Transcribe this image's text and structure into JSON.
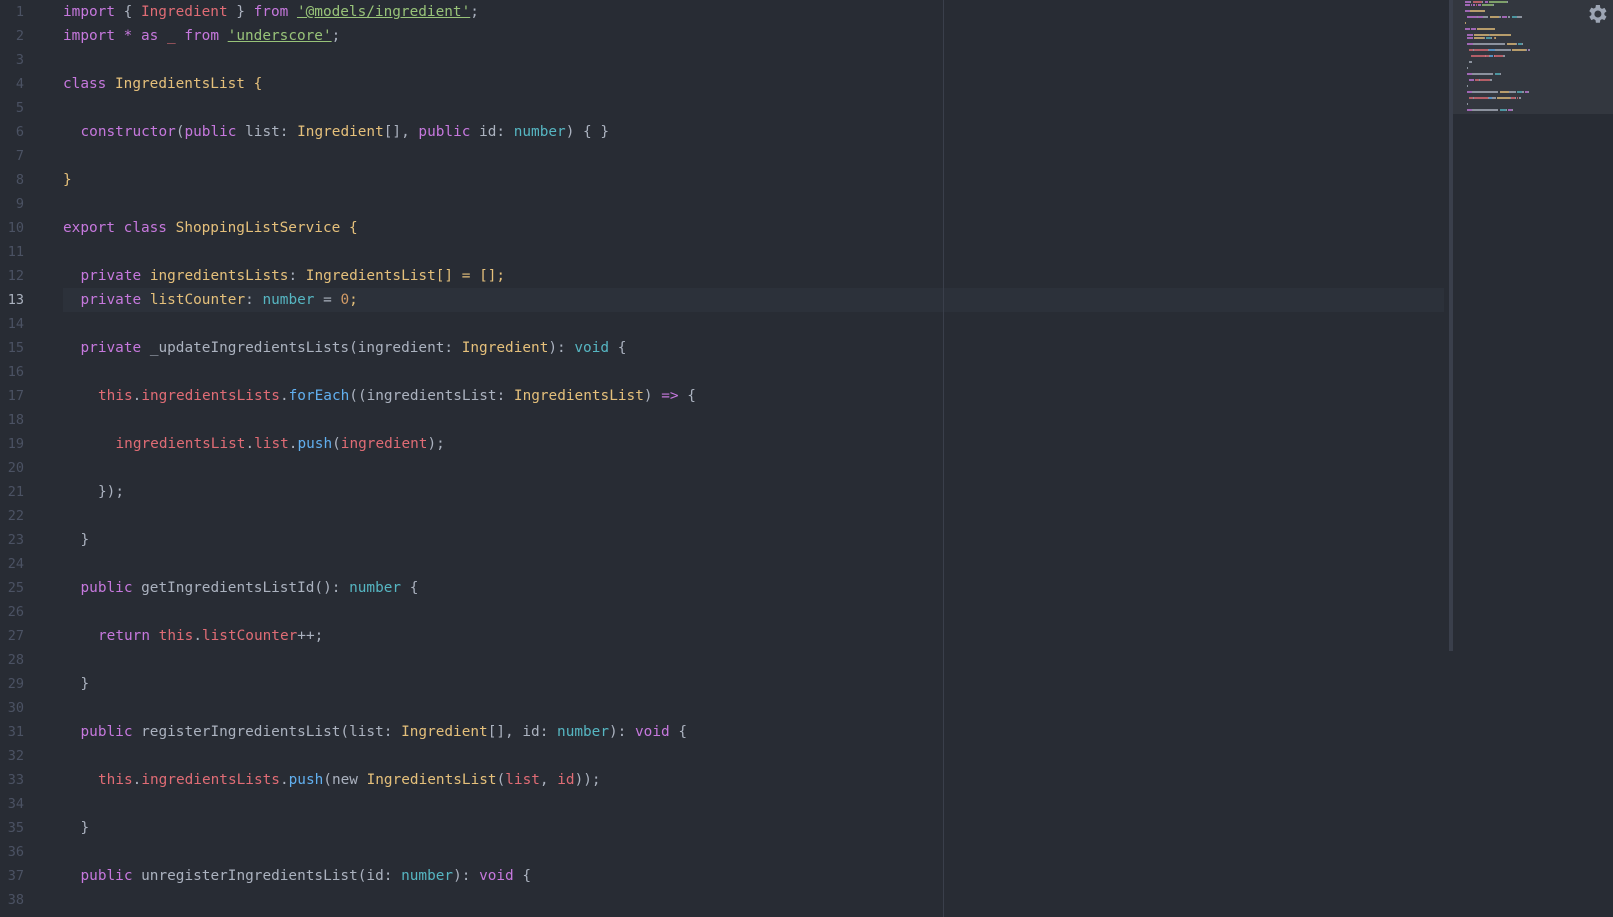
{
  "editor": {
    "current_line": 13,
    "lines": [
      {
        "n": "1",
        "indent": 0,
        "tokens": [
          [
            "import",
            "tok-keyword"
          ],
          [
            " { ",
            "tok-plain"
          ],
          [
            "Ingredient",
            "tok-prop"
          ],
          [
            " } ",
            "tok-plain"
          ],
          [
            "from",
            "tok-keyword"
          ],
          [
            " ",
            "tok-plain"
          ],
          [
            "'@models/ingredient'",
            "tok-string"
          ],
          [
            ";",
            "tok-plain"
          ]
        ]
      },
      {
        "n": "2",
        "indent": 0,
        "tokens": [
          [
            "import",
            "tok-keyword"
          ],
          [
            " ",
            "tok-plain"
          ],
          [
            "*",
            "tok-keyword"
          ],
          [
            " ",
            "tok-plain"
          ],
          [
            "as",
            "tok-keyword"
          ],
          [
            " ",
            "tok-plain"
          ],
          [
            "_",
            "tok-prop"
          ],
          [
            " ",
            "tok-plain"
          ],
          [
            "from",
            "tok-keyword"
          ],
          [
            " ",
            "tok-plain"
          ],
          [
            "'underscore'",
            "tok-string"
          ],
          [
            ";",
            "tok-plain"
          ]
        ]
      },
      {
        "n": "3",
        "indent": 0,
        "tokens": []
      },
      {
        "n": "4",
        "indent": 0,
        "tokens": [
          [
            "class",
            "tok-keyword"
          ],
          [
            " ",
            "tok-plain"
          ],
          [
            "IngredientsList",
            "tok-class"
          ],
          [
            " {",
            "tok-class"
          ]
        ]
      },
      {
        "n": "5",
        "indent": 0,
        "tokens": []
      },
      {
        "n": "6",
        "indent": 1,
        "tokens": [
          [
            "constructor",
            "tok-keyword"
          ],
          [
            "(",
            "tok-plain"
          ],
          [
            "public",
            "tok-keyword"
          ],
          [
            " list: ",
            "tok-plain"
          ],
          [
            "Ingredient",
            "tok-class"
          ],
          [
            "[], ",
            "tok-plain"
          ],
          [
            "public",
            "tok-keyword"
          ],
          [
            " id: ",
            "tok-plain"
          ],
          [
            "number",
            "tok-type"
          ],
          [
            ") { }",
            "tok-plain"
          ]
        ]
      },
      {
        "n": "7",
        "indent": 0,
        "tokens": []
      },
      {
        "n": "8",
        "indent": 0,
        "tokens": [
          [
            "}",
            "tok-class"
          ]
        ]
      },
      {
        "n": "9",
        "indent": 0,
        "tokens": []
      },
      {
        "n": "10",
        "indent": 0,
        "tokens": [
          [
            "export",
            "tok-keyword"
          ],
          [
            " ",
            "tok-plain"
          ],
          [
            "class",
            "tok-keyword"
          ],
          [
            " ",
            "tok-plain"
          ],
          [
            "ShoppingListService",
            "tok-class"
          ],
          [
            " {",
            "tok-class"
          ]
        ]
      },
      {
        "n": "11",
        "indent": 0,
        "tokens": []
      },
      {
        "n": "12",
        "indent": 1,
        "tokens": [
          [
            "private",
            "tok-keyword"
          ],
          [
            " ",
            "tok-plain"
          ],
          [
            "ingredientsLists",
            "tok-class"
          ],
          [
            ": ",
            "tok-plain"
          ],
          [
            "IngredientsList",
            "tok-class"
          ],
          [
            "[] = [];",
            "tok-class"
          ]
        ]
      },
      {
        "n": "13",
        "indent": 1,
        "tokens": [
          [
            "private",
            "tok-keyword"
          ],
          [
            " ",
            "tok-plain"
          ],
          [
            "listCounter",
            "tok-class"
          ],
          [
            ": ",
            "tok-plain"
          ],
          [
            "number",
            "tok-type"
          ],
          [
            " = ",
            "tok-plain"
          ],
          [
            "0",
            "tok-number"
          ],
          [
            ";",
            "tok-class"
          ]
        ]
      },
      {
        "n": "14",
        "indent": 0,
        "tokens": []
      },
      {
        "n": "15",
        "indent": 1,
        "tokens": [
          [
            "private",
            "tok-keyword"
          ],
          [
            " _updateIngredientsLists(ingredient: ",
            "tok-plain"
          ],
          [
            "Ingredient",
            "tok-class"
          ],
          [
            "): ",
            "tok-plain"
          ],
          [
            "void",
            "tok-type"
          ],
          [
            " {",
            "tok-plain"
          ]
        ]
      },
      {
        "n": "16",
        "indent": 0,
        "tokens": []
      },
      {
        "n": "17",
        "indent": 2,
        "tokens": [
          [
            "this",
            "tok-prop"
          ],
          [
            ".",
            "tok-plain"
          ],
          [
            "ingredientsLists",
            "tok-prop"
          ],
          [
            ".",
            "tok-plain"
          ],
          [
            "forEach",
            "tok-func"
          ],
          [
            "((ingredientsList: ",
            "tok-plain"
          ],
          [
            "IngredientsList",
            "tok-class"
          ],
          [
            ") ",
            "tok-plain"
          ],
          [
            "=>",
            "tok-keyword"
          ],
          [
            " {",
            "tok-plain"
          ]
        ]
      },
      {
        "n": "18",
        "indent": 0,
        "tokens": []
      },
      {
        "n": "19",
        "indent": 3,
        "tokens": [
          [
            "ingredientsList",
            "tok-prop"
          ],
          [
            ".",
            "tok-plain"
          ],
          [
            "list",
            "tok-prop"
          ],
          [
            ".",
            "tok-plain"
          ],
          [
            "push",
            "tok-func"
          ],
          [
            "(",
            "tok-plain"
          ],
          [
            "ingredient",
            "tok-prop"
          ],
          [
            ");",
            "tok-plain"
          ]
        ]
      },
      {
        "n": "20",
        "indent": 0,
        "tokens": []
      },
      {
        "n": "21",
        "indent": 2,
        "tokens": [
          [
            "});",
            "tok-plain"
          ]
        ]
      },
      {
        "n": "22",
        "indent": 0,
        "tokens": []
      },
      {
        "n": "23",
        "indent": 1,
        "tokens": [
          [
            "}",
            "tok-plain"
          ]
        ]
      },
      {
        "n": "24",
        "indent": 0,
        "tokens": []
      },
      {
        "n": "25",
        "indent": 1,
        "tokens": [
          [
            "public",
            "tok-keyword"
          ],
          [
            " getIngredientsListId(): ",
            "tok-plain"
          ],
          [
            "number",
            "tok-type"
          ],
          [
            " {",
            "tok-plain"
          ]
        ]
      },
      {
        "n": "26",
        "indent": 0,
        "tokens": []
      },
      {
        "n": "27",
        "indent": 2,
        "tokens": [
          [
            "return",
            "tok-keyword"
          ],
          [
            " ",
            "tok-plain"
          ],
          [
            "this",
            "tok-prop"
          ],
          [
            ".",
            "tok-plain"
          ],
          [
            "listCounter",
            "tok-prop"
          ],
          [
            "++;",
            "tok-plain"
          ]
        ]
      },
      {
        "n": "28",
        "indent": 0,
        "tokens": []
      },
      {
        "n": "29",
        "indent": 1,
        "tokens": [
          [
            "}",
            "tok-plain"
          ]
        ]
      },
      {
        "n": "30",
        "indent": 0,
        "tokens": []
      },
      {
        "n": "31",
        "indent": 1,
        "tokens": [
          [
            "public",
            "tok-keyword"
          ],
          [
            " registerIngredientsList(list: ",
            "tok-plain"
          ],
          [
            "Ingredient",
            "tok-class"
          ],
          [
            "[], id: ",
            "tok-plain"
          ],
          [
            "number",
            "tok-type"
          ],
          [
            "): ",
            "tok-plain"
          ],
          [
            "void",
            "tok-keyword"
          ],
          [
            " {",
            "tok-plain"
          ]
        ]
      },
      {
        "n": "32",
        "indent": 0,
        "tokens": []
      },
      {
        "n": "33",
        "indent": 2,
        "tokens": [
          [
            "this",
            "tok-prop"
          ],
          [
            ".",
            "tok-plain"
          ],
          [
            "ingredientsLists",
            "tok-prop"
          ],
          [
            ".",
            "tok-plain"
          ],
          [
            "push",
            "tok-func"
          ],
          [
            "(new ",
            "tok-plain"
          ],
          [
            "IngredientsList",
            "tok-class"
          ],
          [
            "(",
            "tok-plain"
          ],
          [
            "list",
            "tok-prop"
          ],
          [
            ", ",
            "tok-plain"
          ],
          [
            "id",
            "tok-prop"
          ],
          [
            "));",
            "tok-plain"
          ]
        ]
      },
      {
        "n": "34",
        "indent": 0,
        "tokens": []
      },
      {
        "n": "35",
        "indent": 1,
        "tokens": [
          [
            "}",
            "tok-plain"
          ]
        ]
      },
      {
        "n": "36",
        "indent": 0,
        "tokens": []
      },
      {
        "n": "37",
        "indent": 1,
        "tokens": [
          [
            "public",
            "tok-keyword"
          ],
          [
            " unregisterIngredientsList(id: ",
            "tok-plain"
          ],
          [
            "number",
            "tok-type"
          ],
          [
            "): ",
            "tok-plain"
          ],
          [
            "void",
            "tok-keyword"
          ],
          [
            " {",
            "tok-plain"
          ]
        ]
      },
      {
        "n": "38",
        "indent": 0,
        "tokens": []
      }
    ]
  },
  "minimap": {
    "visible_range": [
      1,
      38
    ]
  },
  "settings": {
    "icon": "gear-icon"
  },
  "colors": {
    "background": "#282c34",
    "keyword": "#c678dd",
    "class": "#e5c07b",
    "type": "#56b6c2",
    "string": "#98c379",
    "property": "#e06c75",
    "function": "#61afef",
    "number": "#d19a66",
    "plain": "#abb2bf",
    "gutter": "#4b5263"
  }
}
